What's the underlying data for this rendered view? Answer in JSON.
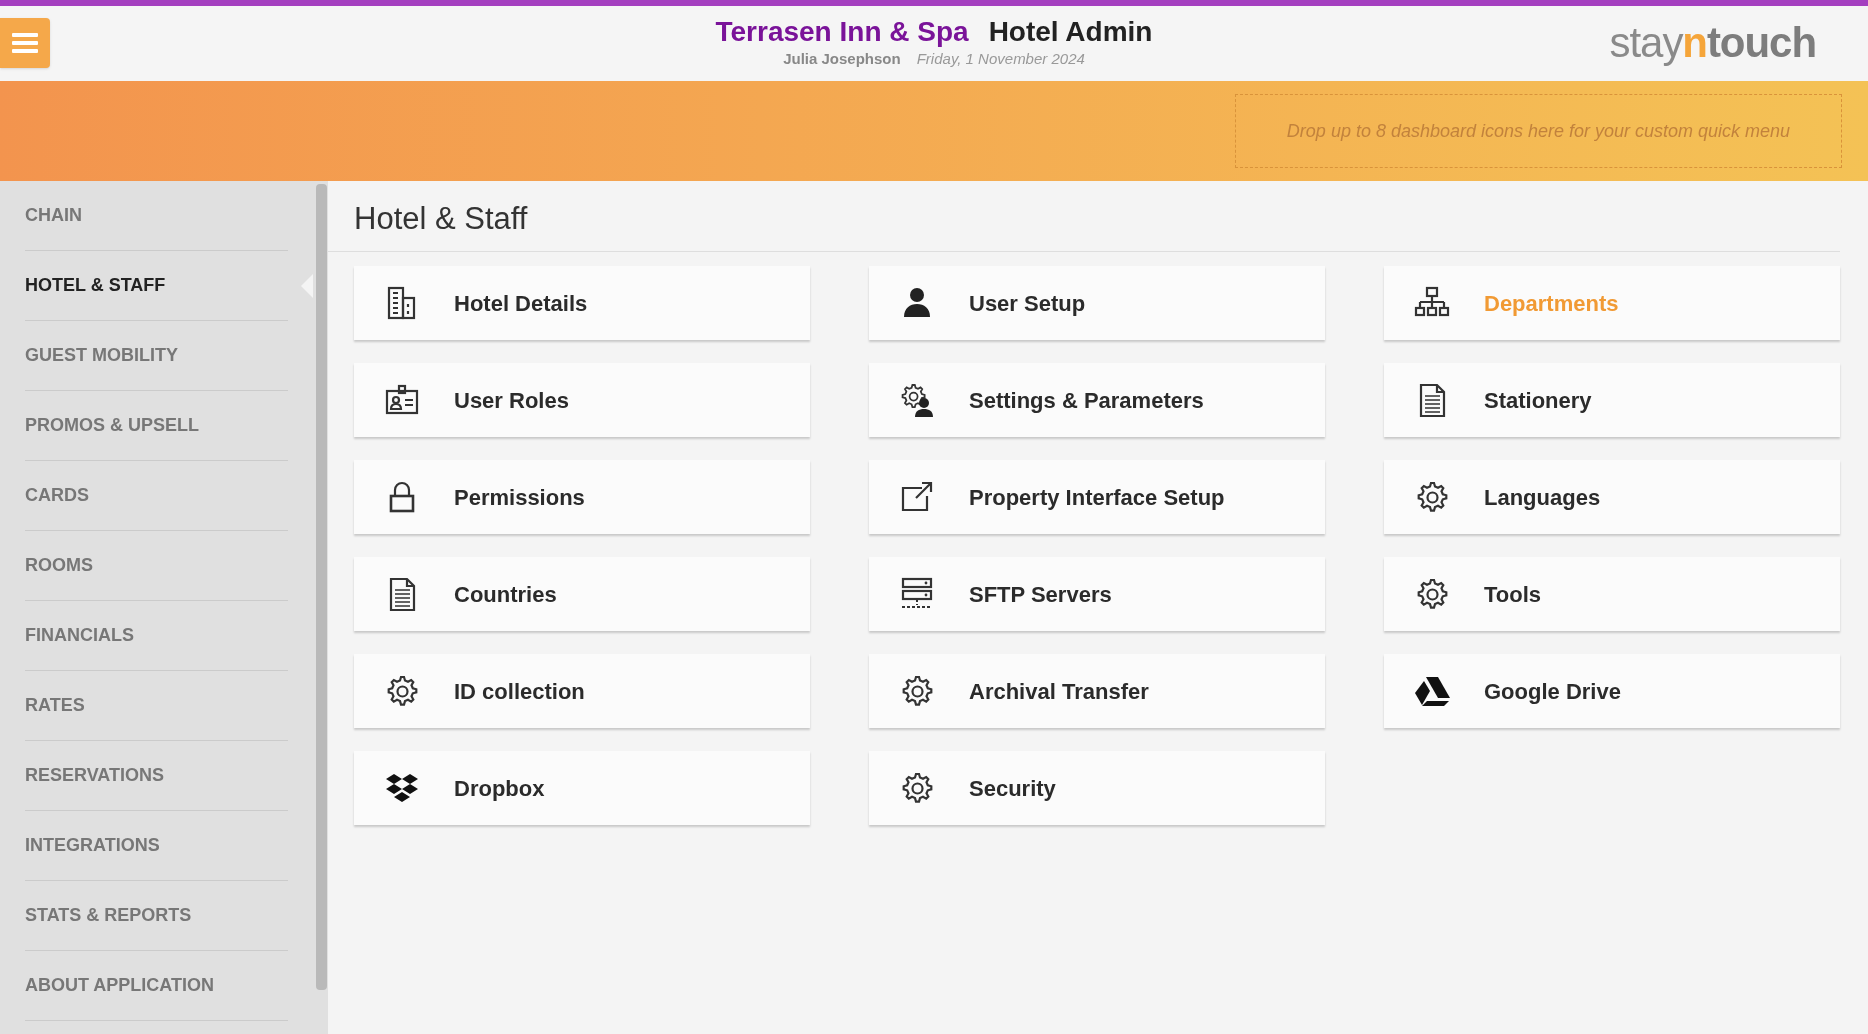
{
  "header": {
    "property": "Terrasen Inn & Spa",
    "app": "Hotel Admin",
    "user": "Julia Josephson",
    "date": "Friday, 1 November 2024",
    "logo": [
      "stay",
      "n",
      "touch"
    ]
  },
  "quick_menu": {
    "placeholder": "Drop up to 8 dashboard icons here for your custom quick menu"
  },
  "sidebar": {
    "items": [
      {
        "label": "CHAIN",
        "selected": false
      },
      {
        "label": "HOTEL & STAFF",
        "selected": true
      },
      {
        "label": "GUEST MOBILITY",
        "selected": false
      },
      {
        "label": "PROMOS & UPSELL",
        "selected": false
      },
      {
        "label": "CARDS",
        "selected": false
      },
      {
        "label": "ROOMS",
        "selected": false
      },
      {
        "label": "FINANCIALS",
        "selected": false
      },
      {
        "label": "RATES",
        "selected": false
      },
      {
        "label": "RESERVATIONS",
        "selected": false
      },
      {
        "label": "INTEGRATIONS",
        "selected": false
      },
      {
        "label": "STATS & REPORTS",
        "selected": false
      },
      {
        "label": "ABOUT APPLICATION",
        "selected": false
      }
    ]
  },
  "page_title": "Hotel & Staff",
  "tiles": [
    {
      "label": "Hotel Details",
      "kind": "building",
      "selected": false
    },
    {
      "label": "User Setup",
      "kind": "person",
      "selected": false
    },
    {
      "label": "Departments",
      "kind": "sitemap",
      "selected": true
    },
    {
      "label": "User Roles",
      "kind": "badge",
      "selected": false
    },
    {
      "label": "Settings & Parameters",
      "kind": "gearperson",
      "selected": false
    },
    {
      "label": "Stationery",
      "kind": "document",
      "selected": false
    },
    {
      "label": "Permissions",
      "kind": "lock",
      "selected": false
    },
    {
      "label": "Property Interface Setup",
      "kind": "external",
      "selected": false
    },
    {
      "label": "Languages",
      "kind": "gear",
      "selected": false
    },
    {
      "label": "Countries",
      "kind": "document",
      "selected": false
    },
    {
      "label": "SFTP Servers",
      "kind": "server",
      "selected": false
    },
    {
      "label": "Tools",
      "kind": "gear",
      "selected": false
    },
    {
      "label": "ID collection",
      "kind": "gear",
      "selected": false
    },
    {
      "label": "Archival Transfer",
      "kind": "gear",
      "selected": false
    },
    {
      "label": "Google Drive",
      "kind": "drive",
      "selected": false
    },
    {
      "label": "Dropbox",
      "kind": "dropbox",
      "selected": false
    },
    {
      "label": "Security",
      "kind": "gear",
      "selected": false
    }
  ]
}
